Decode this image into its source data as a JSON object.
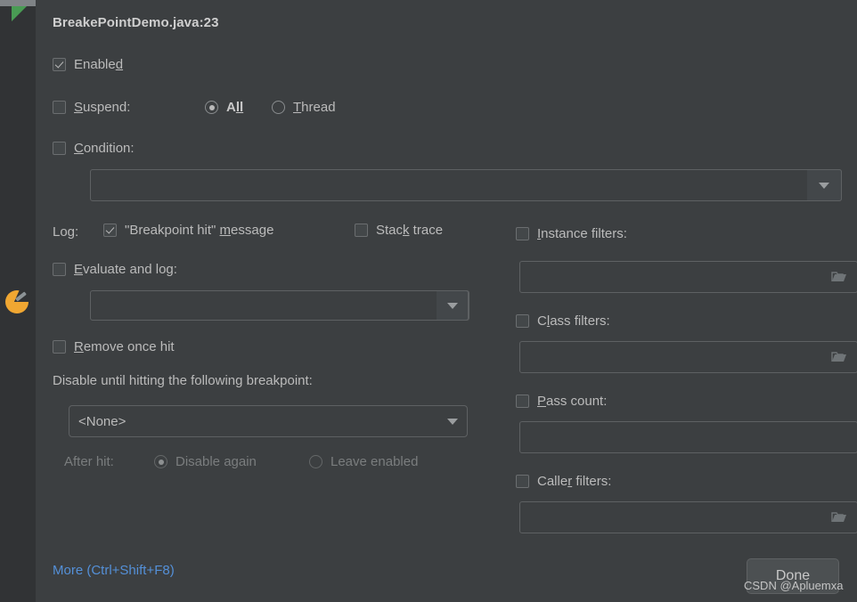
{
  "window": {
    "title": "BreakePointDemo.java:23"
  },
  "gutter": {
    "run_marker_icon": "green-triangle-icon",
    "breakpoint_icon": "breakpoint-marker-icon"
  },
  "left_column": {
    "enabled": {
      "label_pre": "Enable",
      "label_mnemonic": "d",
      "label_post": "",
      "checked": true
    },
    "suspend": {
      "label_mnemonic": "S",
      "label_post": "uspend:",
      "checked": false,
      "options": [
        {
          "label_pre": "A",
          "label_mnemonic": "ll",
          "selected": true
        },
        {
          "label_mnemonic": "T",
          "label_post": "hread",
          "selected": false
        }
      ]
    },
    "condition": {
      "label_mnemonic": "C",
      "label_post": "ondition:",
      "checked": false,
      "value": "",
      "expand_icon": "expand-icon",
      "dropdown_icon": "chevron-down-icon"
    },
    "log": {
      "label": "Log:",
      "message": {
        "label_pre": "\"Breakpoint hit\" ",
        "label_mnemonic": "m",
        "label_post": "essage",
        "checked": true
      },
      "stack_trace": {
        "label_pre": "Stac",
        "label_mnemonic": "k",
        "label_post": " trace",
        "checked": false
      }
    },
    "evaluate_and_log": {
      "label_mnemonic": "E",
      "label_post": "valuate and log:",
      "checked": false,
      "value": "",
      "expand_icon": "expand-icon",
      "dropdown_icon": "chevron-down-icon"
    },
    "remove_once_hit": {
      "label_mnemonic": "R",
      "label_post": "emove once hit",
      "checked": false
    },
    "disable_until": {
      "label": "Disable until hitting the following breakpoint:",
      "selected_option": "<None>",
      "dropdown_icon": "chevron-down-icon"
    },
    "after_hit": {
      "label": "After hit:",
      "disabled": true,
      "options": [
        {
          "label": "Disable again",
          "selected": true
        },
        {
          "label": "Leave enabled",
          "selected": false
        }
      ]
    }
  },
  "right_column": {
    "instance_filters": {
      "label_mnemonic": "I",
      "label_post": "nstance filters:",
      "checked": false,
      "value": "",
      "browse_icon": "folder-icon"
    },
    "class_filters": {
      "label_pre": "C",
      "label_mnemonic": "l",
      "label_post": "ass filters:",
      "checked": false,
      "value": "",
      "browse_icon": "folder-icon"
    },
    "pass_count": {
      "label_mnemonic": "P",
      "label_post": "ass count:",
      "checked": false,
      "value": ""
    },
    "caller_filters": {
      "label_pre": "Calle",
      "label_mnemonic": "r",
      "label_post": " filters:",
      "checked": false,
      "value": "",
      "browse_icon": "folder-icon"
    }
  },
  "footer": {
    "more_link": "More (Ctrl+Shift+F8)",
    "done_button": "Done",
    "watermark": "CSDN @Apluemxa"
  },
  "colors": {
    "panel_bg": "#3c3f41",
    "gutter_bg": "#313335",
    "text": "#bbbbbb",
    "link": "#5490d8",
    "accent_green": "#499c54",
    "breakpoint_orange": "#f0a732",
    "border": "#5e6163"
  }
}
